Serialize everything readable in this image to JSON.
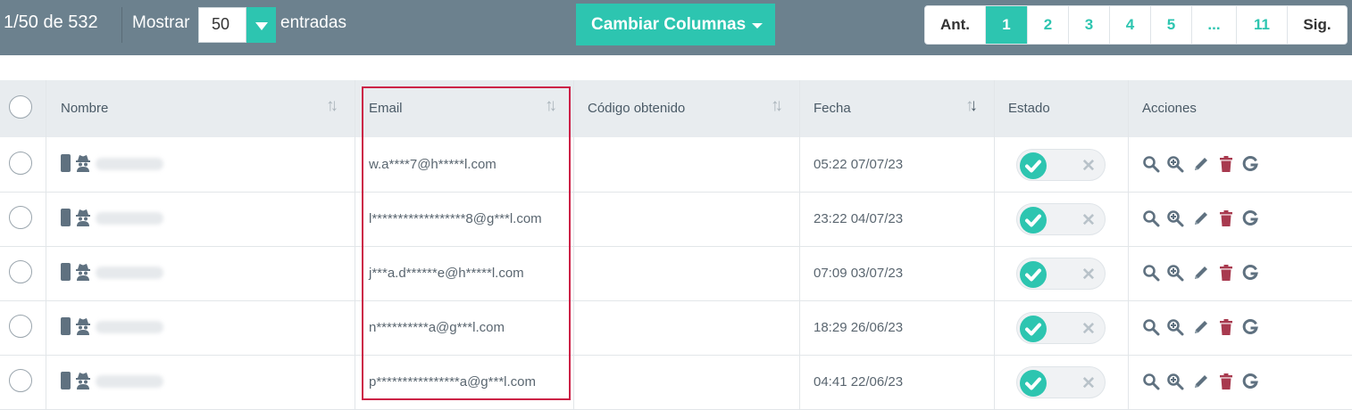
{
  "toolbar": {
    "count": "1/50 de 532",
    "show_label": "Mostrar",
    "page_size": "50",
    "entries_label": "entradas",
    "columns_button": "Cambiar Columnas"
  },
  "pagination": {
    "prev": "Ant.",
    "pages": [
      "1",
      "2",
      "3",
      "4",
      "5",
      "...",
      "11"
    ],
    "next": "Sig.",
    "active": "1"
  },
  "table": {
    "columns": {
      "name": "Nombre",
      "email": "Email",
      "code": "Código obtenido",
      "date": "Fecha",
      "status": "Estado",
      "actions": "Acciones"
    },
    "sorted_column": "Fecha",
    "sort_direction": "desc",
    "rows": [
      {
        "email": "w.a****7@h*****l.com",
        "code": "",
        "date": "05:22 07/07/23",
        "active": true
      },
      {
        "email": "l******************8@g***l.com",
        "code": "",
        "date": "23:22 04/07/23",
        "active": true
      },
      {
        "email": "j***a.d******e@h*****l.com",
        "code": "",
        "date": "07:09 03/07/23",
        "active": true
      },
      {
        "email": "n**********a@g***l.com",
        "code": "",
        "date": "18:29 26/06/23",
        "active": true
      },
      {
        "email": "p****************a@g***l.com",
        "code": "",
        "date": "04:41 22/06/23",
        "active": true
      }
    ]
  },
  "row_icons": [
    "mobile-phone-icon",
    "user-secret-icon"
  ],
  "row_actions": [
    "search-icon",
    "zoom-in-icon",
    "pencil-icon",
    "trash-icon",
    "google-icon"
  ],
  "colors": {
    "toolbar_bg": "#6c818e",
    "accent": "#2dc5b0",
    "delete": "#a83a4f",
    "highlight_border": "#cc1f46"
  }
}
